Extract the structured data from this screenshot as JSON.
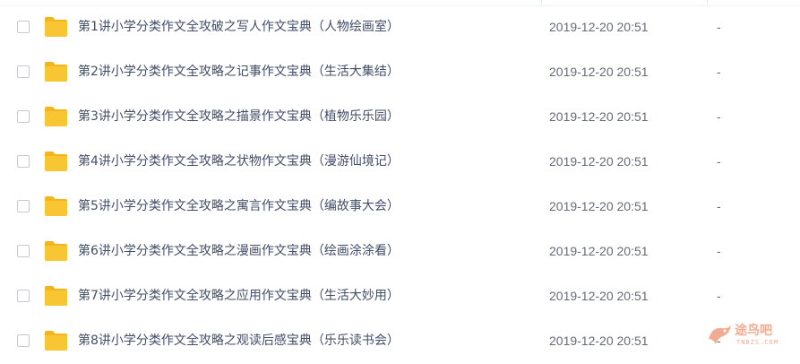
{
  "files": [
    {
      "name": "第1讲小学分类作文全攻破之写人作文宝典（人物绘画室）",
      "modified": "2019-12-20 20:51",
      "size": "-"
    },
    {
      "name": "第2讲小学分类作文全攻略之记事作文宝典（生活大集结）",
      "modified": "2019-12-20 20:51",
      "size": "-"
    },
    {
      "name": "第3讲小学分类作文全攻略之描景作文宝典（植物乐乐园）",
      "modified": "2019-12-20 20:51",
      "size": "-"
    },
    {
      "name": "第4讲小学分类作文全攻略之状物作文宝典（漫游仙境记）",
      "modified": "2019-12-20 20:51",
      "size": "-"
    },
    {
      "name": "第5讲小学分类作文全攻略之寓言作文宝典（编故事大会）",
      "modified": "2019-12-20 20:51",
      "size": "-"
    },
    {
      "name": "第6讲小学分类作文全攻略之漫画作文宝典（绘画涂涂看）",
      "modified": "2019-12-20 20:51",
      "size": "-"
    },
    {
      "name": "第7讲小学分类作文全攻略之应用作文宝典（生活大妙用）",
      "modified": "2019-12-20 20:51",
      "size": "-"
    },
    {
      "name": "第8讲小学分类作文全攻略之观读后感宝典（乐乐读书会）",
      "modified": "2019-12-20 20:51",
      "size": "-"
    }
  ],
  "icons": {
    "folder": "folder-icon",
    "checkbox": "checkbox"
  },
  "colors": {
    "folder": "#f9c633",
    "folder_tab": "#f3b51e",
    "text": "#424e67",
    "meta_text": "#666b76",
    "watermark": "#e46a3a"
  },
  "watermark": {
    "text": "途鸟吧",
    "subtext": "TNBZS.COM"
  }
}
